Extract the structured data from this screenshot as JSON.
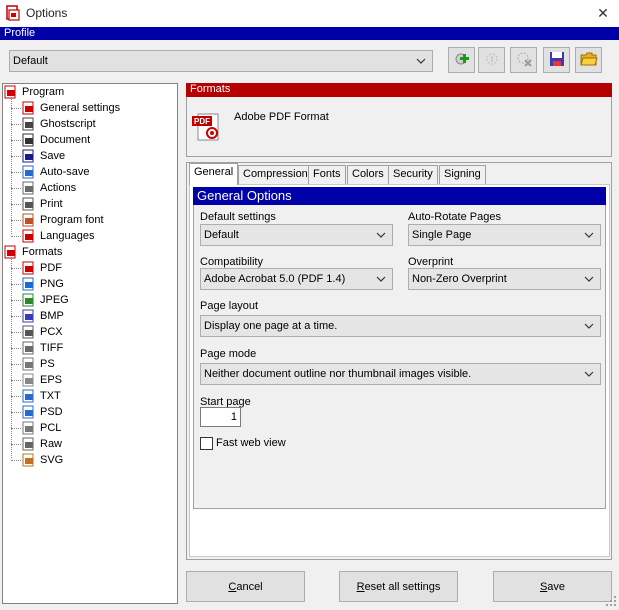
{
  "window": {
    "title": "Options",
    "close_glyph": "✕"
  },
  "profile": {
    "header": "Profile",
    "selected": "Default",
    "toolbar_icons": [
      "add-profile-icon",
      "rename-profile-icon",
      "delete-profile-icon",
      "save-profile-icon",
      "open-folder-icon"
    ]
  },
  "tree": {
    "program": {
      "label": "Program",
      "children": [
        "General settings",
        "Ghostscript",
        "Document",
        "Save",
        "Auto-save",
        "Actions",
        "Print",
        "Program font",
        "Languages"
      ]
    },
    "formats": {
      "label": "Formats",
      "children": [
        "PDF",
        "PNG",
        "JPEG",
        "BMP",
        "PCX",
        "TIFF",
        "PS",
        "EPS",
        "TXT",
        "PSD",
        "PCL",
        "Raw",
        "SVG"
      ]
    }
  },
  "formats_panel": {
    "header": "Formats",
    "title": "Adobe PDF Format",
    "icon_text": "PDF"
  },
  "tabs": [
    "General",
    "Compression",
    "Fonts",
    "Colors",
    "Security",
    "Signing"
  ],
  "active_tab": "General",
  "general": {
    "header": "General Options",
    "default_settings": {
      "label": "Default settings",
      "value": "Default"
    },
    "auto_rotate": {
      "label": "Auto-Rotate Pages",
      "value": "Single Page"
    },
    "compatibility": {
      "label": "Compatibility",
      "value": "Adobe Acrobat 5.0 (PDF 1.4)"
    },
    "overprint": {
      "label": "Overprint",
      "value": "Non-Zero Overprint"
    },
    "page_layout": {
      "label": "Page layout",
      "value": "Display one page at a time."
    },
    "page_mode": {
      "label": "Page mode",
      "value": "Neither document outline nor thumbnail images visible."
    },
    "start_page": {
      "label": "Start page",
      "value": "1"
    },
    "fast_web_view": {
      "label": "Fast web view",
      "checked": false
    }
  },
  "buttons": {
    "cancel": {
      "mnemonic": "C",
      "rest": "ancel"
    },
    "reset": {
      "mnemonic": "R",
      "rest": "eset all settings"
    },
    "save": {
      "mnemonic": "S",
      "rest": "ave"
    }
  },
  "colors": {
    "profile_bar": "#0000a8",
    "formats_bar": "#b40000",
    "general_bar": "#0000a8"
  }
}
